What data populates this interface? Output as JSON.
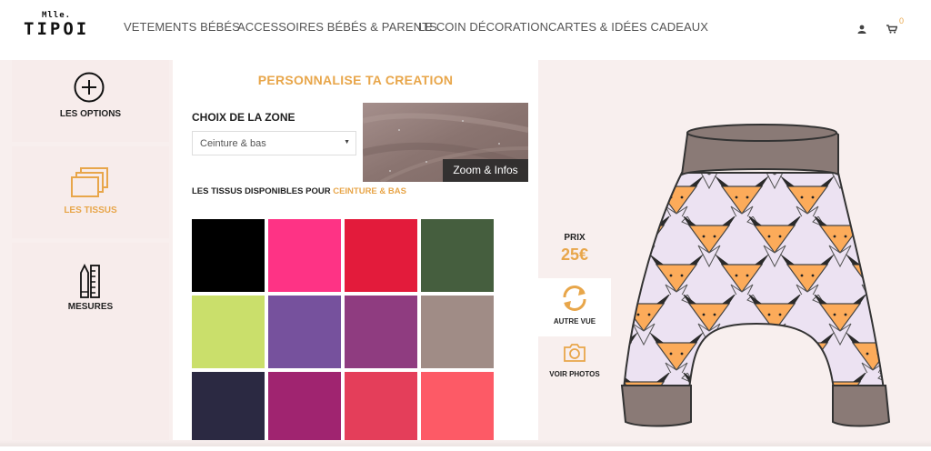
{
  "header": {
    "logo_small": "Mlle.",
    "logo_big": "TIPOI",
    "nav": [
      "VETEMENTS BÉBÉS",
      "ACCESSOIRES BÉBÉS & PARENTS",
      "LE COIN DÉCORATION",
      "CARTES & IDÉES CADEAUX"
    ],
    "cart_count": "0",
    "icons": [
      "user-icon",
      "cart-icon"
    ]
  },
  "sidebar": {
    "items": [
      {
        "label": "LES OPTIONS",
        "icon": "plus-circle-icon",
        "active": false
      },
      {
        "label": "LES TISSUS",
        "icon": "fabric-layers-icon",
        "active": true
      },
      {
        "label": "MESURES",
        "icon": "ruler-pencil-icon",
        "active": false
      }
    ]
  },
  "panel": {
    "title": "PERSONNALISE TA CREATION",
    "zone_label": "CHOIX DE LA ZONE",
    "zone_value": "Ceinture & bas",
    "zoom_label": "Zoom & Infos",
    "available_prefix": "LES TISSUS DISPONIBLES POUR",
    "available_zone": "CEINTURE & BAS",
    "swatches": [
      "#000000",
      "#fe3385",
      "#e31b3b",
      "#455e3e",
      "#cadf6b",
      "#76519d",
      "#8f3c80",
      "#a08c86",
      "#2b2942",
      "#a02470",
      "#e43e5a",
      "#fd5a66"
    ]
  },
  "product": {
    "price_label": "PRIX",
    "price_value": "25€",
    "other_view_label": "AUTRE VUE",
    "photos_label": "VOIR PHOTOS"
  },
  "colors": {
    "accent": "#e8a64a",
    "band": "#8a7a76",
    "pants_base": "#ece2f2",
    "fox_orange": "#fcab5a"
  }
}
